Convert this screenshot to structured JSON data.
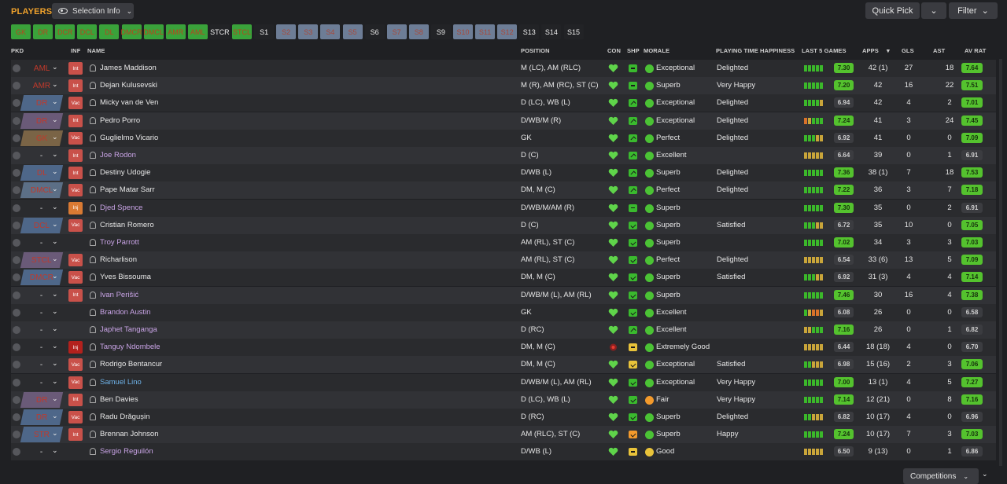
{
  "header": {
    "title": "PLAYERS",
    "selection_info": "Selection Info",
    "quick_pick": "Quick Pick",
    "filter": "Filter"
  },
  "position_chips": [
    {
      "label": "GK",
      "style": "g"
    },
    {
      "label": "DR",
      "style": "g"
    },
    {
      "label": "DCR",
      "style": "g"
    },
    {
      "label": "DCL",
      "style": "g"
    },
    {
      "label": "DL",
      "style": "g"
    },
    {
      "label": "DMCR",
      "style": "g"
    },
    {
      "label": "DMCL",
      "style": "g"
    },
    {
      "label": "AMR",
      "style": "g"
    },
    {
      "label": "AML",
      "style": "g"
    },
    {
      "label": "STCR",
      "style": "n"
    },
    {
      "label": "STCL",
      "style": "g"
    },
    {
      "label": "S1",
      "style": "n"
    },
    {
      "label": "S2",
      "style": "b"
    },
    {
      "label": "S3",
      "style": "b"
    },
    {
      "label": "S4",
      "style": "b"
    },
    {
      "label": "S5",
      "style": "b"
    },
    {
      "label": "S6",
      "style": "n"
    },
    {
      "label": "S7",
      "style": "b"
    },
    {
      "label": "S8",
      "style": "b"
    },
    {
      "label": "S9",
      "style": "n"
    },
    {
      "label": "S10",
      "style": "b"
    },
    {
      "label": "S11",
      "style": "b"
    },
    {
      "label": "S12",
      "style": "b"
    },
    {
      "label": "S13",
      "style": "n"
    },
    {
      "label": "S14",
      "style": "n"
    },
    {
      "label": "S15",
      "style": "n"
    }
  ],
  "columns": {
    "pkd": "PKD",
    "inf": "INF",
    "name": "NAME",
    "position": "POSITION",
    "con": "CON",
    "shp": "SHP",
    "morale": "MORALE",
    "happiness": "PLAYING TIME HAPPINESS",
    "last5": "LAST 5 GAMES",
    "apps": "APPS",
    "gls": "GLS",
    "ast": "AST",
    "avrat": "AV RAT"
  },
  "players": [
    {
      "pkd": "AML",
      "pkd_style": "t0",
      "inf": "Int",
      "inf_style": "int",
      "name": "James Maddison",
      "name_style": "",
      "position": "M (LC), AM (RLC)",
      "shp": "dash",
      "shp_color": "g",
      "morale": "Exceptional",
      "morale_color": "g",
      "happiness": "Delighted",
      "last5": [
        "g",
        "g",
        "g",
        "g",
        "g"
      ],
      "last_rating": "7.30",
      "rating_style": "g",
      "apps": "42 (1)",
      "gls": "27",
      "ast": "18",
      "avrat": "7.64",
      "avrat_style": "g"
    },
    {
      "pkd": "AMR",
      "pkd_style": "t0",
      "inf": "Int",
      "inf_style": "int",
      "name": "Dejan Kulusevski",
      "name_style": "",
      "position": "M (R), AM (RC), ST (C)",
      "shp": "dash",
      "shp_color": "g",
      "morale": "Superb",
      "morale_color": "g",
      "happiness": "Very Happy",
      "last5": [
        "g",
        "g",
        "g",
        "g",
        "g"
      ],
      "last_rating": "7.20",
      "rating_style": "g",
      "apps": "42",
      "gls": "16",
      "ast": "22",
      "avrat": "7.51",
      "avrat_style": "g"
    },
    {
      "pkd": "DR",
      "pkd_style": "t1",
      "inf": "Vac",
      "inf_style": "vac",
      "name": "Micky van de Ven",
      "name_style": "",
      "position": "D (LC), WB (L)",
      "shp": "u",
      "shp_color": "g",
      "morale": "Exceptional",
      "morale_color": "g",
      "happiness": "Delighted",
      "last5": [
        "g",
        "g",
        "g",
        "g",
        "y"
      ],
      "last_rating": "6.94",
      "rating_style": "d",
      "apps": "42",
      "gls": "4",
      "ast": "2",
      "avrat": "7.01",
      "avrat_style": "g"
    },
    {
      "pkd": "DR",
      "pkd_style": "t2",
      "inf": "Int",
      "inf_style": "int",
      "name": "Pedro Porro",
      "name_style": "",
      "position": "D/WB/M (R)",
      "shp": "u",
      "shp_color": "g",
      "morale": "Exceptional",
      "morale_color": "g",
      "happiness": "Delighted",
      "last5": [
        "o",
        "y",
        "g",
        "g",
        "g"
      ],
      "last_rating": "7.24",
      "rating_style": "g",
      "apps": "41",
      "gls": "3",
      "ast": "24",
      "avrat": "7.45",
      "avrat_style": "g"
    },
    {
      "pkd": "GK",
      "pkd_style": "t3",
      "inf": "Vac",
      "inf_style": "vac",
      "name": "Guglielmo Vicario",
      "name_style": "",
      "position": "GK",
      "shp": "u",
      "shp_color": "g",
      "morale": "Perfect",
      "morale_color": "g",
      "happiness": "Delighted",
      "last5": [
        "g",
        "g",
        "g",
        "y",
        "y"
      ],
      "last_rating": "6.92",
      "rating_style": "d",
      "apps": "41",
      "gls": "0",
      "ast": "0",
      "avrat": "7.09",
      "avrat_style": "g"
    },
    {
      "pkd": "-",
      "pkd_style": "dash",
      "inf": "Int",
      "inf_style": "int",
      "name": "Joe Rodon",
      "name_style": "l",
      "position": "D (C)",
      "shp": "u",
      "shp_color": "g",
      "morale": "Excellent",
      "morale_color": "g",
      "happiness": "",
      "last5": [
        "y",
        "y",
        "y",
        "y",
        "y"
      ],
      "last_rating": "6.64",
      "rating_style": "d",
      "apps": "39",
      "gls": "0",
      "ast": "1",
      "avrat": "6.91",
      "avrat_style": "d"
    },
    {
      "pkd": "DL",
      "pkd_style": "t1",
      "inf": "Int",
      "inf_style": "int",
      "name": "Destiny Udogie",
      "name_style": "",
      "position": "D/WB (L)",
      "shp": "u",
      "shp_color": "g",
      "morale": "Superb",
      "morale_color": "g",
      "happiness": "Delighted",
      "last5": [
        "g",
        "g",
        "g",
        "g",
        "g"
      ],
      "last_rating": "7.36",
      "rating_style": "g",
      "apps": "38 (1)",
      "gls": "7",
      "ast": "18",
      "avrat": "7.53",
      "avrat_style": "g"
    },
    {
      "pkd": "DMCL",
      "pkd_style": "t4",
      "inf": "Vac",
      "inf_style": "vac",
      "name": "Pape Matar Sarr",
      "name_style": "",
      "position": "DM, M (C)",
      "shp": "u",
      "shp_color": "g",
      "morale": "Perfect",
      "morale_color": "g",
      "happiness": "Delighted",
      "last5": [
        "g",
        "g",
        "g",
        "g",
        "g"
      ],
      "last_rating": "7.22",
      "rating_style": "g",
      "apps": "36",
      "gls": "3",
      "ast": "7",
      "avrat": "7.18",
      "avrat_style": "g"
    },
    {
      "pkd": "-",
      "pkd_style": "dash",
      "inf": "Inj",
      "inf_style": "inj",
      "name": "Djed Spence",
      "name_style": "l",
      "position": "D/WB/M/AM (R)",
      "shp": "dash",
      "shp_color": "g",
      "morale": "Superb",
      "morale_color": "g",
      "happiness": "",
      "last5": [
        "g",
        "g",
        "g",
        "g",
        "g"
      ],
      "last_rating": "7.30",
      "rating_style": "g",
      "apps": "35",
      "gls": "0",
      "ast": "2",
      "avrat": "6.91",
      "avrat_style": "d"
    },
    {
      "pkd": "DCL",
      "pkd_style": "t1",
      "inf": "Vac",
      "inf_style": "vac",
      "name": "Cristian Romero",
      "name_style": "",
      "position": "D (C)",
      "shp": "dn",
      "shp_color": "g",
      "morale": "Superb",
      "morale_color": "g",
      "happiness": "Satisfied",
      "last5": [
        "g",
        "g",
        "g",
        "y",
        "y"
      ],
      "last_rating": "6.72",
      "rating_style": "d",
      "apps": "35",
      "gls": "10",
      "ast": "0",
      "avrat": "7.05",
      "avrat_style": "g"
    },
    {
      "pkd": "-",
      "pkd_style": "dash",
      "inf": "",
      "inf_style": "",
      "name": "Troy Parrott",
      "name_style": "l",
      "position": "AM (RL), ST (C)",
      "shp": "dn",
      "shp_color": "g",
      "morale": "Superb",
      "morale_color": "g",
      "happiness": "",
      "last5": [
        "g",
        "g",
        "g",
        "g",
        "g"
      ],
      "last_rating": "7.02",
      "rating_style": "g",
      "apps": "34",
      "gls": "3",
      "ast": "3",
      "avrat": "7.03",
      "avrat_style": "g"
    },
    {
      "pkd": "STCL",
      "pkd_style": "t2",
      "inf": "Vac",
      "inf_style": "vac",
      "name": "Richarlison",
      "name_style": "",
      "position": "AM (RL), ST (C)",
      "shp": "dn",
      "shp_color": "g",
      "morale": "Perfect",
      "morale_color": "g",
      "happiness": "Delighted",
      "last5": [
        "y",
        "y",
        "y",
        "y",
        "y"
      ],
      "last_rating": "6.54",
      "rating_style": "d",
      "apps": "33 (6)",
      "gls": "13",
      "ast": "5",
      "avrat": "7.09",
      "avrat_style": "g"
    },
    {
      "pkd": "DMCR",
      "pkd_style": "t1",
      "inf": "Vac",
      "inf_style": "vac",
      "name": "Yves Bissouma",
      "name_style": "",
      "position": "DM, M (C)",
      "shp": "dn",
      "shp_color": "g",
      "morale": "Superb",
      "morale_color": "g",
      "happiness": "Satisfied",
      "last5": [
        "g",
        "g",
        "g",
        "y",
        "y"
      ],
      "last_rating": "6.92",
      "rating_style": "d",
      "apps": "31 (3)",
      "gls": "4",
      "ast": "4",
      "avrat": "7.14",
      "avrat_style": "g"
    },
    {
      "pkd": "-",
      "pkd_style": "dash",
      "inf": "Int",
      "inf_style": "int",
      "name": "Ivan Perišić",
      "name_style": "l",
      "position": "D/WB/M (L), AM (RL)",
      "shp": "dn",
      "shp_color": "g",
      "morale": "Superb",
      "morale_color": "g",
      "happiness": "",
      "last5": [
        "g",
        "g",
        "g",
        "g",
        "g"
      ],
      "last_rating": "7.46",
      "rating_style": "g",
      "apps": "30",
      "gls": "16",
      "ast": "4",
      "avrat": "7.38",
      "avrat_style": "g"
    },
    {
      "pkd": "-",
      "pkd_style": "dash",
      "inf": "",
      "inf_style": "",
      "name": "Brandon Austin",
      "name_style": "l",
      "position": "GK",
      "shp": "dn",
      "shp_color": "g",
      "morale": "Excellent",
      "morale_color": "g",
      "happiness": "",
      "last5": [
        "g",
        "y",
        "o",
        "o",
        "y"
      ],
      "last_rating": "6.08",
      "rating_style": "d",
      "apps": "26",
      "gls": "0",
      "ast": "0",
      "avrat": "6.58",
      "avrat_style": "d"
    },
    {
      "pkd": "-",
      "pkd_style": "dash",
      "inf": "",
      "inf_style": "",
      "name": "Japhet Tanganga",
      "name_style": "l",
      "position": "D (RC)",
      "shp": "u",
      "shp_color": "g",
      "morale": "Excellent",
      "morale_color": "g",
      "happiness": "",
      "last5": [
        "y",
        "y",
        "g",
        "g",
        "g"
      ],
      "last_rating": "7.16",
      "rating_style": "g",
      "apps": "26",
      "gls": "0",
      "ast": "1",
      "avrat": "6.82",
      "avrat_style": "d"
    },
    {
      "pkd": "-",
      "pkd_style": "dash",
      "inf": "Inj",
      "inf_style": "injr",
      "name": "Tanguy Ndombele",
      "name_style": "l",
      "position": "DM, M (C)",
      "shp": "dash",
      "shp_color": "y",
      "morale": "Extremely Good",
      "morale_color": "g",
      "happiness": "",
      "last5": [
        "y",
        "y",
        "y",
        "y",
        "y"
      ],
      "last_rating": "6.44",
      "rating_style": "d",
      "apps": "18 (18)",
      "gls": "4",
      "ast": "0",
      "avrat": "6.70",
      "avrat_style": "d"
    },
    {
      "pkd": "-",
      "pkd_style": "dash",
      "inf": "Vac",
      "inf_style": "vac",
      "name": "Rodrigo Bentancur",
      "name_style": "",
      "position": "DM, M (C)",
      "shp": "dn",
      "shp_color": "y",
      "morale": "Exceptional",
      "morale_color": "g",
      "happiness": "Satisfied",
      "last5": [
        "g",
        "g",
        "y",
        "y",
        "y"
      ],
      "last_rating": "6.98",
      "rating_style": "d",
      "apps": "15 (16)",
      "gls": "2",
      "ast": "3",
      "avrat": "7.06",
      "avrat_style": "g"
    },
    {
      "pkd": "-",
      "pkd_style": "dash",
      "inf": "Vac",
      "inf_style": "vac",
      "name": "Samuel Lino",
      "name_style": "s",
      "position": "D/WB/M (L), AM (RL)",
      "shp": "dn",
      "shp_color": "g",
      "morale": "Exceptional",
      "morale_color": "g",
      "happiness": "Very Happy",
      "last5": [
        "g",
        "g",
        "g",
        "g",
        "g"
      ],
      "last_rating": "7.00",
      "rating_style": "g",
      "apps": "13 (1)",
      "gls": "4",
      "ast": "5",
      "avrat": "7.27",
      "avrat_style": "g"
    },
    {
      "pkd": "DR",
      "pkd_style": "t2",
      "inf": "Int",
      "inf_style": "int",
      "name": "Ben Davies",
      "name_style": "",
      "position": "D (LC), WB (L)",
      "shp": "dn",
      "shp_color": "g",
      "morale": "Fair",
      "morale_color": "o",
      "happiness": "Very Happy",
      "last5": [
        "g",
        "g",
        "g",
        "g",
        "g"
      ],
      "last_rating": "7.14",
      "rating_style": "g",
      "apps": "12 (21)",
      "gls": "0",
      "ast": "8",
      "avrat": "7.16",
      "avrat_style": "g"
    },
    {
      "pkd": "DR",
      "pkd_style": "t1",
      "inf": "Vac",
      "inf_style": "vac",
      "name": "Radu Drăgușin",
      "name_style": "",
      "position": "D (RC)",
      "shp": "dn",
      "shp_color": "g",
      "morale": "Superb",
      "morale_color": "g",
      "happiness": "Delighted",
      "last5": [
        "g",
        "g",
        "y",
        "y",
        "y"
      ],
      "last_rating": "6.82",
      "rating_style": "d",
      "apps": "10 (17)",
      "gls": "4",
      "ast": "0",
      "avrat": "6.96",
      "avrat_style": "d"
    },
    {
      "pkd": "STR",
      "pkd_style": "t1",
      "inf": "Int",
      "inf_style": "int",
      "name": "Brennan Johnson",
      "name_style": "",
      "position": "AM (RLC), ST (C)",
      "shp": "dn",
      "shp_color": "o",
      "morale": "Superb",
      "morale_color": "g",
      "happiness": "Happy",
      "last5": [
        "g",
        "g",
        "g",
        "g",
        "g"
      ],
      "last_rating": "7.24",
      "rating_style": "g",
      "apps": "10 (17)",
      "gls": "7",
      "ast": "3",
      "avrat": "7.03",
      "avrat_style": "g"
    },
    {
      "pkd": "-",
      "pkd_style": "dash",
      "inf": "",
      "inf_style": "",
      "name": "Sergio Reguilón",
      "name_style": "l",
      "position": "D/WB (L)",
      "shp": "dash",
      "shp_color": "y",
      "morale": "Good",
      "morale_color": "y",
      "happiness": "",
      "last5": [
        "y",
        "y",
        "y",
        "y",
        "y"
      ],
      "last_rating": "6.50",
      "rating_style": "d",
      "apps": "9 (13)",
      "gls": "0",
      "ast": "1",
      "avrat": "6.86",
      "avrat_style": "d"
    }
  ],
  "footer": {
    "competitions": "Competitions"
  },
  "colors": {
    "accent": "#f0a22c",
    "good": "#54c22e",
    "warn": "#e9c33a",
    "bad": "#c9514a"
  }
}
